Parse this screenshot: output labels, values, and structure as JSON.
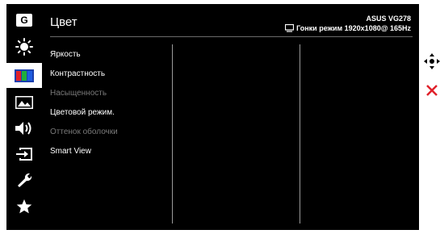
{
  "header": {
    "title": "Цвет",
    "model": "ASUS VG278",
    "mode": "Гонки режим 1920x1080@ 165Hz"
  },
  "sidebar": {
    "items": [
      {
        "icon": "gaming-icon",
        "label": "G"
      },
      {
        "icon": "brightness-icon"
      },
      {
        "icon": "color-bars-icon",
        "active": true
      },
      {
        "icon": "image-icon"
      },
      {
        "icon": "sound-icon"
      },
      {
        "icon": "input-select-icon"
      },
      {
        "icon": "wrench-icon"
      },
      {
        "icon": "star-icon"
      }
    ]
  },
  "menu": {
    "items": [
      {
        "label": "Яркость",
        "enabled": true
      },
      {
        "label": "Контрастность",
        "enabled": true
      },
      {
        "label": "Насыщенность",
        "enabled": false
      },
      {
        "label": "Цветовой режим.",
        "enabled": true
      },
      {
        "label": "Оттенок оболочки",
        "enabled": false
      },
      {
        "label": "Smart View",
        "enabled": true
      }
    ]
  },
  "nav": {
    "move_icon": "move-joystick-icon",
    "exit_icon": "close-icon",
    "exit_color": "#e0202a"
  },
  "colors": {
    "osd_background": "#000000",
    "active_background": "#ffffff",
    "disabled_text": "#7a7a7a"
  }
}
